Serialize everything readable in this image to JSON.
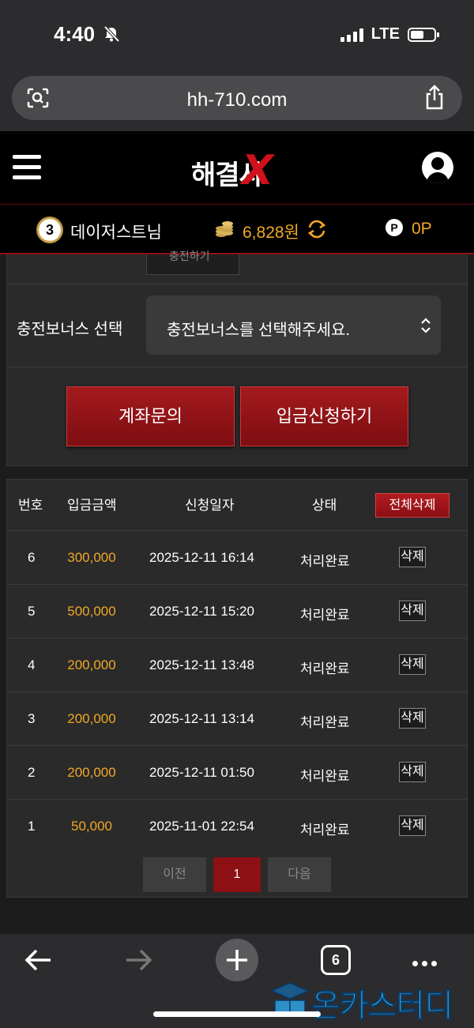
{
  "status": {
    "time": "4:40",
    "network": "LTE"
  },
  "browser": {
    "url": "hh-710.com",
    "tab_count": "6"
  },
  "site": {
    "logo_text": "해결사",
    "user": {
      "level": "3",
      "name": "데이저스트님",
      "balance": "6,828원",
      "points": "0P",
      "point_symbol": "P"
    }
  },
  "form": {
    "partial_button": "충전하기",
    "bonus_label": "충전보너스 선택",
    "bonus_placeholder": "충전보너스를 선택해주세요.",
    "inquiry_button": "계좌문의",
    "apply_button": "입금신청하기"
  },
  "history": {
    "headers": {
      "no": "번호",
      "amount": "입금금액",
      "date": "신청일자",
      "status": "상태",
      "delete_all": "전체삭제"
    },
    "rows": [
      {
        "no": "6",
        "amount": "300,000",
        "date": "2025-12-11 16:14",
        "status": "처리완료",
        "delete": "삭제"
      },
      {
        "no": "5",
        "amount": "500,000",
        "date": "2025-12-11 15:20",
        "status": "처리완료",
        "delete": "삭제"
      },
      {
        "no": "4",
        "amount": "200,000",
        "date": "2025-12-11 13:48",
        "status": "처리완료",
        "delete": "삭제"
      },
      {
        "no": "3",
        "amount": "200,000",
        "date": "2025-12-11 13:14",
        "status": "처리완료",
        "delete": "삭제"
      },
      {
        "no": "2",
        "amount": "200,000",
        "date": "2025-12-11 01:50",
        "status": "처리완료",
        "delete": "삭제"
      },
      {
        "no": "1",
        "amount": "50,000",
        "date": "2025-11-01 22:54",
        "status": "처리완료",
        "delete": "삭제"
      }
    ],
    "pager": {
      "prev": "이전",
      "current": "1",
      "next": "다음"
    }
  },
  "watermark": "온카스터디",
  "colors": {
    "accent_red": "#8c1014",
    "amount_orange": "#f0a826",
    "panel_bg": "#2a2a2a"
  }
}
